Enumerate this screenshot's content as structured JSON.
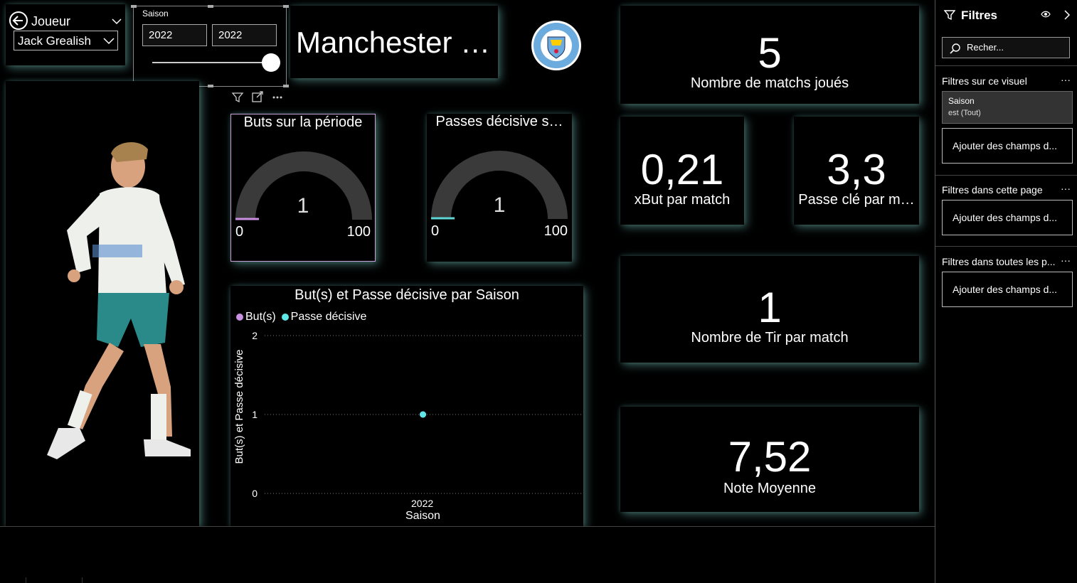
{
  "player_slicer": {
    "title": "Joueur",
    "selected": "Jack Grealish"
  },
  "season_slicer": {
    "title": "Saison",
    "from": "2022",
    "to": "2022"
  },
  "dashboard_title": "Manchester …",
  "gauges": [
    {
      "title": "Buts sur la période",
      "value": "1",
      "min": "0",
      "max": "100",
      "color": "#c98fe0"
    },
    {
      "title": "Passes décisive s…",
      "value": "1",
      "min": "0",
      "max": "100",
      "color": "#5fd6d6"
    }
  ],
  "chart_data": {
    "type": "line",
    "title": "But(s) et Passe décisive par Saison",
    "xlabel": "Saison",
    "ylabel": "But(s) et Passe décisive",
    "categories": [
      "2022"
    ],
    "series": [
      {
        "name": "But(s)",
        "values": [
          1
        ],
        "color": "#c98fe0"
      },
      {
        "name": "Passe décisive",
        "values": [
          1
        ],
        "color": "#5fe6e6"
      }
    ],
    "yticks": [
      "0",
      "1",
      "2"
    ],
    "ylim": [
      0,
      2
    ],
    "legend": "top-left",
    "grid": true
  },
  "kpis": {
    "matches": {
      "value": "5",
      "label": "Nombre de matchs joués"
    },
    "xbut": {
      "value": "0,21",
      "label": "xBut par match"
    },
    "passe_cle": {
      "value": "3,3",
      "label": "Passe clé par m…"
    },
    "tirs": {
      "value": "1",
      "label": "Nombre de Tir par match"
    },
    "note": {
      "value": "7,52",
      "label": "Note Moyenne"
    }
  },
  "filter_pane": {
    "title": "Filtres",
    "search_placeholder": "Recher...",
    "sections": {
      "visual": "Filtres sur ce visuel",
      "page": "Filtres dans cette page",
      "all_pages": "Filtres dans toutes les p..."
    },
    "more": "···",
    "season_filter": {
      "name": "Saison",
      "state": "est (Tout)"
    },
    "add_fields": "Ajouter des champs d..."
  },
  "colors": {
    "accent_glow": "#78c8be",
    "background": "#000000"
  }
}
